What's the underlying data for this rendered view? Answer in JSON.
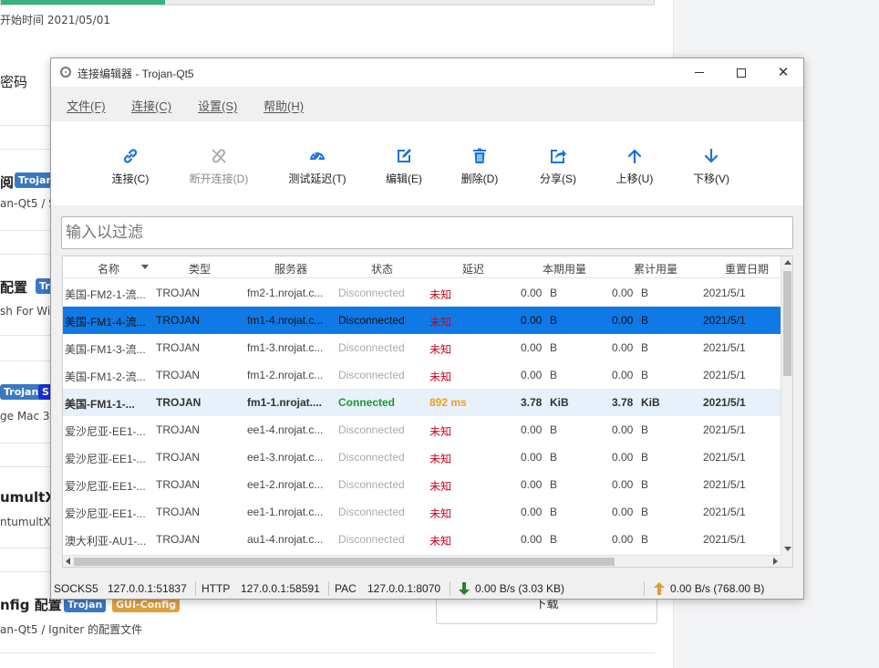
{
  "background": {
    "start_time": "开始时间 2021/05/01",
    "password_label": "密码",
    "sub1_label": "阅",
    "sub1_tag": "Trojan",
    "sub1_desc": "an-Qt5 / S",
    "sub2_label": "配置",
    "sub2_tag": "Tr",
    "sub2_desc": "sh For Wir",
    "sub3_tag1": "Trojan",
    "sub3_tag2": "S",
    "sub3_desc": "ge Mac 3",
    "sub4_label": "umultX",
    "sub4_desc": "ntumultX",
    "sub5_label": "nfig 配置",
    "sub5_tag1": "Trojan",
    "sub5_tag2": "GUI-Config",
    "sub5_desc": "an-Qt5 / Igniter 的配置文件",
    "download_label": "下载"
  },
  "window": {
    "title": "连接编辑器 - Trojan-Qt5",
    "controls": {
      "minimize": "minimize",
      "maximize": "maximize",
      "close": "✕"
    }
  },
  "menu": [
    {
      "label": "文件(F)"
    },
    {
      "label": "连接(C)"
    },
    {
      "label": "设置(S)"
    },
    {
      "label": "帮助(H)"
    }
  ],
  "toolbar": [
    {
      "label": "连接(C)",
      "icon": "link-icon",
      "enabled": true
    },
    {
      "label": "断开连接(D)",
      "icon": "unlink-icon",
      "enabled": false
    },
    {
      "label": "测试延迟(T)",
      "icon": "speedometer-icon",
      "enabled": true
    },
    {
      "label": "编辑(E)",
      "icon": "edit-icon",
      "enabled": true
    },
    {
      "label": "删除(D)",
      "icon": "trash-icon",
      "enabled": true
    },
    {
      "label": "分享(S)",
      "icon": "share-icon",
      "enabled": true
    },
    {
      "label": "上移(U)",
      "icon": "arrow-up-icon",
      "enabled": true
    },
    {
      "label": "下移(V)",
      "icon": "arrow-down-icon",
      "enabled": true
    }
  ],
  "filter": {
    "placeholder": "输入以过滤"
  },
  "table": {
    "columns": [
      "名称",
      "类型",
      "服务器",
      "状态",
      "延迟",
      "本期用量",
      "累计用量",
      "重置日期"
    ],
    "rows": [
      {
        "name": "美国-FM2-1-流...",
        "type": "TROJAN",
        "server": "fm2-1.nrojat.c...",
        "status": "Disconnected",
        "latency": "未知",
        "cur_val": "0.00",
        "cur_unit": "B",
        "total_val": "0.00",
        "total_unit": "B",
        "reset": "2021/5/1",
        "state": "disc"
      },
      {
        "name": "美国-FM1-4-流...",
        "type": "TROJAN",
        "server": "fm1-4.nrojat.c...",
        "status": "Disconnected",
        "latency": "未知",
        "cur_val": "0.00",
        "cur_unit": "B",
        "total_val": "0.00",
        "total_unit": "B",
        "reset": "2021/5/1",
        "state": "selected"
      },
      {
        "name": "美国-FM1-3-流...",
        "type": "TROJAN",
        "server": "fm1-3.nrojat.c...",
        "status": "Disconnected",
        "latency": "未知",
        "cur_val": "0.00",
        "cur_unit": "B",
        "total_val": "0.00",
        "total_unit": "B",
        "reset": "2021/5/1",
        "state": "disc"
      },
      {
        "name": "美国-FM1-2-流...",
        "type": "TROJAN",
        "server": "fm1-2.nrojat.c...",
        "status": "Disconnected",
        "latency": "未知",
        "cur_val": "0.00",
        "cur_unit": "B",
        "total_val": "0.00",
        "total_unit": "B",
        "reset": "2021/5/1",
        "state": "disc"
      },
      {
        "name": "美国-FM1-1-...",
        "type": "TROJAN",
        "server": "fm1-1.nrojat....",
        "status": "Connected",
        "latency": "892 ms",
        "cur_val": "3.78",
        "cur_unit": "KiB",
        "total_val": "3.78",
        "total_unit": "KiB",
        "reset": "2021/5/1",
        "state": "connected"
      },
      {
        "name": "爱沙尼亚-EE1-...",
        "type": "TROJAN",
        "server": "ee1-4.nrojat.c...",
        "status": "Disconnected",
        "latency": "未知",
        "cur_val": "0.00",
        "cur_unit": "B",
        "total_val": "0.00",
        "total_unit": "B",
        "reset": "2021/5/1",
        "state": "disc"
      },
      {
        "name": "爱沙尼亚-EE1-...",
        "type": "TROJAN",
        "server": "ee1-3.nrojat.c...",
        "status": "Disconnected",
        "latency": "未知",
        "cur_val": "0.00",
        "cur_unit": "B",
        "total_val": "0.00",
        "total_unit": "B",
        "reset": "2021/5/1",
        "state": "disc"
      },
      {
        "name": "爱沙尼亚-EE1-...",
        "type": "TROJAN",
        "server": "ee1-2.nrojat.c...",
        "status": "Disconnected",
        "latency": "未知",
        "cur_val": "0.00",
        "cur_unit": "B",
        "total_val": "0.00",
        "total_unit": "B",
        "reset": "2021/5/1",
        "state": "disc"
      },
      {
        "name": "爱沙尼亚-EE1-...",
        "type": "TROJAN",
        "server": "ee1-1.nrojat.c...",
        "status": "Disconnected",
        "latency": "未知",
        "cur_val": "0.00",
        "cur_unit": "B",
        "total_val": "0.00",
        "total_unit": "B",
        "reset": "2021/5/1",
        "state": "disc"
      },
      {
        "name": "澳大利亚-AU1-...",
        "type": "TROJAN",
        "server": "au1-4.nrojat.c...",
        "status": "Disconnected",
        "latency": "未知",
        "cur_val": "0.00",
        "cur_unit": "B",
        "total_val": "0.00",
        "total_unit": "B",
        "reset": "2021/5/1",
        "state": "disc"
      }
    ]
  },
  "statusbar": {
    "socks_label": "SOCKS5",
    "socks_addr": "127.0.0.1:51837",
    "http_label": "HTTP",
    "http_addr": "127.0.0.1:58591",
    "pac_label": "PAC",
    "pac_addr": "127.0.0.1:8070",
    "download_rate": "0.00 B/s (3.03 KB)",
    "upload_rate": "0.00 B/s (768.00 B)"
  },
  "colors": {
    "accent": "#1a73d8",
    "selected_row": "#0f7ae5",
    "connected_row": "#e6f1fb",
    "connected_text": "#1c9a2e",
    "latency_unknown": "#d0021b",
    "latency_ok": "#f0a020",
    "download_arrow": "#2e7d32",
    "upload_arrow": "#e09a3a"
  }
}
